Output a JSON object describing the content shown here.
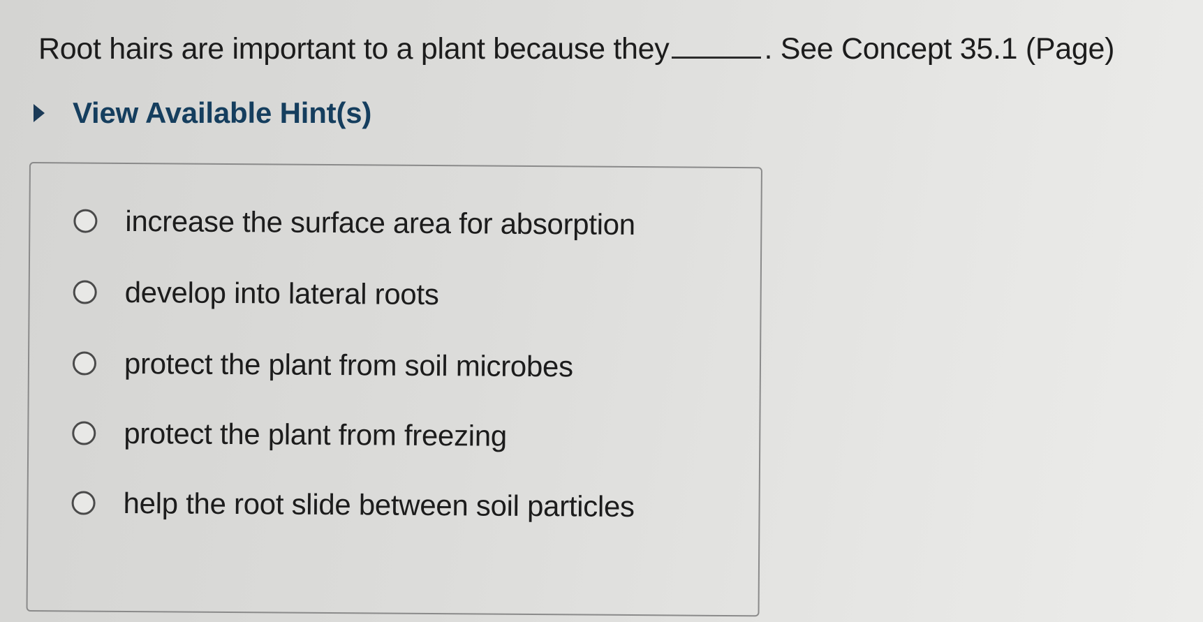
{
  "question": {
    "text_before": "Root hairs are important to a plant because they",
    "text_after": ". See Concept 35.1 (Page)"
  },
  "hints": {
    "label": "View Available Hint(s)",
    "icon": "caret-right-icon"
  },
  "choices": [
    {
      "label": "increase the surface area for absorption",
      "selected": false
    },
    {
      "label": "develop into lateral roots",
      "selected": false
    },
    {
      "label": "protect the plant from soil microbes",
      "selected": false
    },
    {
      "label": "protect the plant from freezing",
      "selected": false
    },
    {
      "label": "help the root slide between soil particles",
      "selected": false
    }
  ],
  "colors": {
    "hint_text": "#153e5e",
    "body_text": "#1c1c1c",
    "box_border": "#8a8a8a"
  }
}
